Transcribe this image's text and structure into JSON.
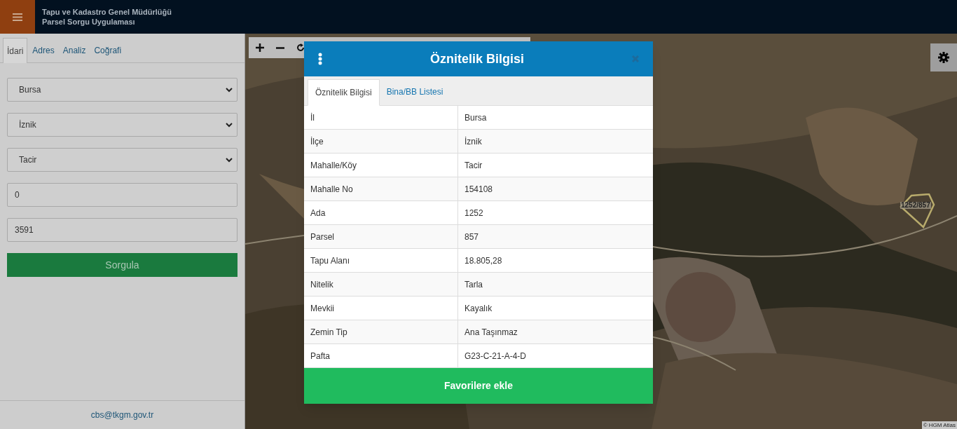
{
  "header": {
    "title_lines": [
      "Tapu ve Kadastro Genel Müdürlüğü",
      "Parsel Sorgu Uygulaması"
    ]
  },
  "sidebar": {
    "tabs": [
      {
        "label": "İdari",
        "selected": true
      },
      {
        "label": "Adres",
        "selected": false
      },
      {
        "label": "Analiz",
        "selected": false
      },
      {
        "label": "Coğrafi",
        "selected": false
      }
    ],
    "fields": [
      {
        "kind": "select",
        "value": "Bursa"
      },
      {
        "kind": "select",
        "value": "İznik"
      },
      {
        "kind": "select",
        "value": "Tacir"
      },
      {
        "kind": "input",
        "value": "0"
      },
      {
        "kind": "input",
        "value": "3591"
      }
    ],
    "button": "Sorgula",
    "footer_email": "cbs@tkgm.gov.tr"
  },
  "map": {
    "parcel_label": "1252/857",
    "attribution": "© HGM Atlas"
  },
  "dialog": {
    "title": "Öznitelik Bilgisi",
    "tabs": [
      {
        "label": "Öznitelik Bilgisi",
        "selected": true
      },
      {
        "label": "Bina/BB Listesi",
        "selected": false
      }
    ],
    "rows": [
      {
        "label": "İl",
        "value": "Bursa"
      },
      {
        "label": "İlçe",
        "value": "İznik"
      },
      {
        "label": "Mahalle/Köy",
        "value": "Tacir"
      },
      {
        "label": "Mahalle No",
        "value": "154108"
      },
      {
        "label": "Ada",
        "value": "1252"
      },
      {
        "label": "Parsel",
        "value": "857"
      },
      {
        "label": "Tapu Alanı",
        "value": "18.805,28"
      },
      {
        "label": "Nitelik",
        "value": "Tarla"
      },
      {
        "label": "Mevkii",
        "value": "Kayalık"
      },
      {
        "label": "Zemin Tip",
        "value": "Ana Taşınmaz"
      },
      {
        "label": "Pafta",
        "value": "G23-C-21-A-4-D"
      }
    ],
    "button": "Favorilere ekle"
  }
}
